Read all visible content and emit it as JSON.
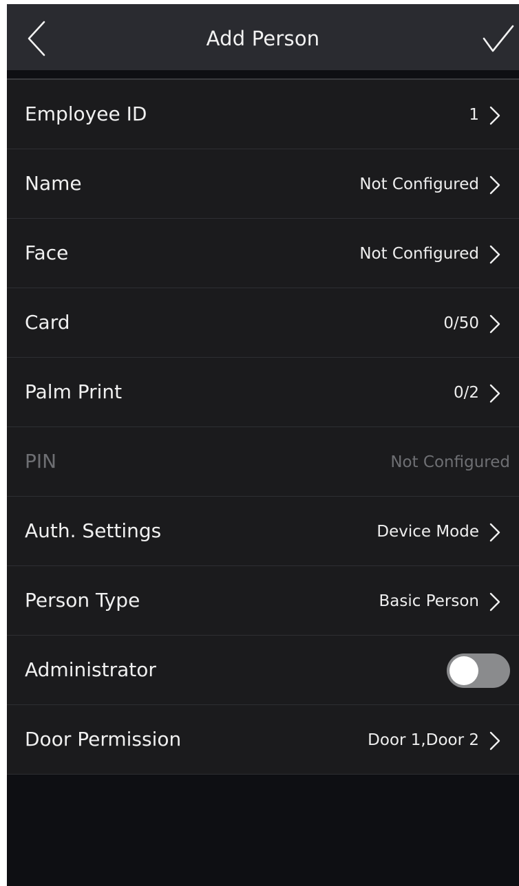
{
  "header": {
    "title": "Add Person",
    "back_icon": "chevron-left-icon",
    "confirm_icon": "checkmark-icon"
  },
  "rows": [
    {
      "label": "Employee ID",
      "value": "1",
      "icon": "chevron-right-icon"
    },
    {
      "label": "Name",
      "value": "Not Configured",
      "icon": "chevron-right-icon"
    },
    {
      "label": "Face",
      "value": "Not Configured",
      "icon": "chevron-right-icon"
    },
    {
      "label": "Card",
      "value": "0/50",
      "icon": "chevron-right-icon"
    },
    {
      "label": "Palm Print",
      "value": "0/2",
      "icon": "chevron-right-icon"
    },
    {
      "label": "PIN",
      "value": "Not Configured",
      "enabled": false
    },
    {
      "label": "Auth. Settings",
      "value": "Device Mode",
      "icon": "chevron-right-icon"
    },
    {
      "label": "Person Type",
      "value": "Basic Person",
      "icon": "chevron-right-icon"
    },
    {
      "label": "Administrator",
      "toggle_on": false
    },
    {
      "label": "Door Permission",
      "value": "Door 1,Door 2",
      "icon": "chevron-right-icon"
    }
  ],
  "colors": {
    "background": "#0e0f13",
    "header": "#2a2b30",
    "row": "#1b1b1d",
    "text": "#f0f0f0",
    "disabled_text": "#6e6f73",
    "toggle_off": "#8a8b8d"
  }
}
